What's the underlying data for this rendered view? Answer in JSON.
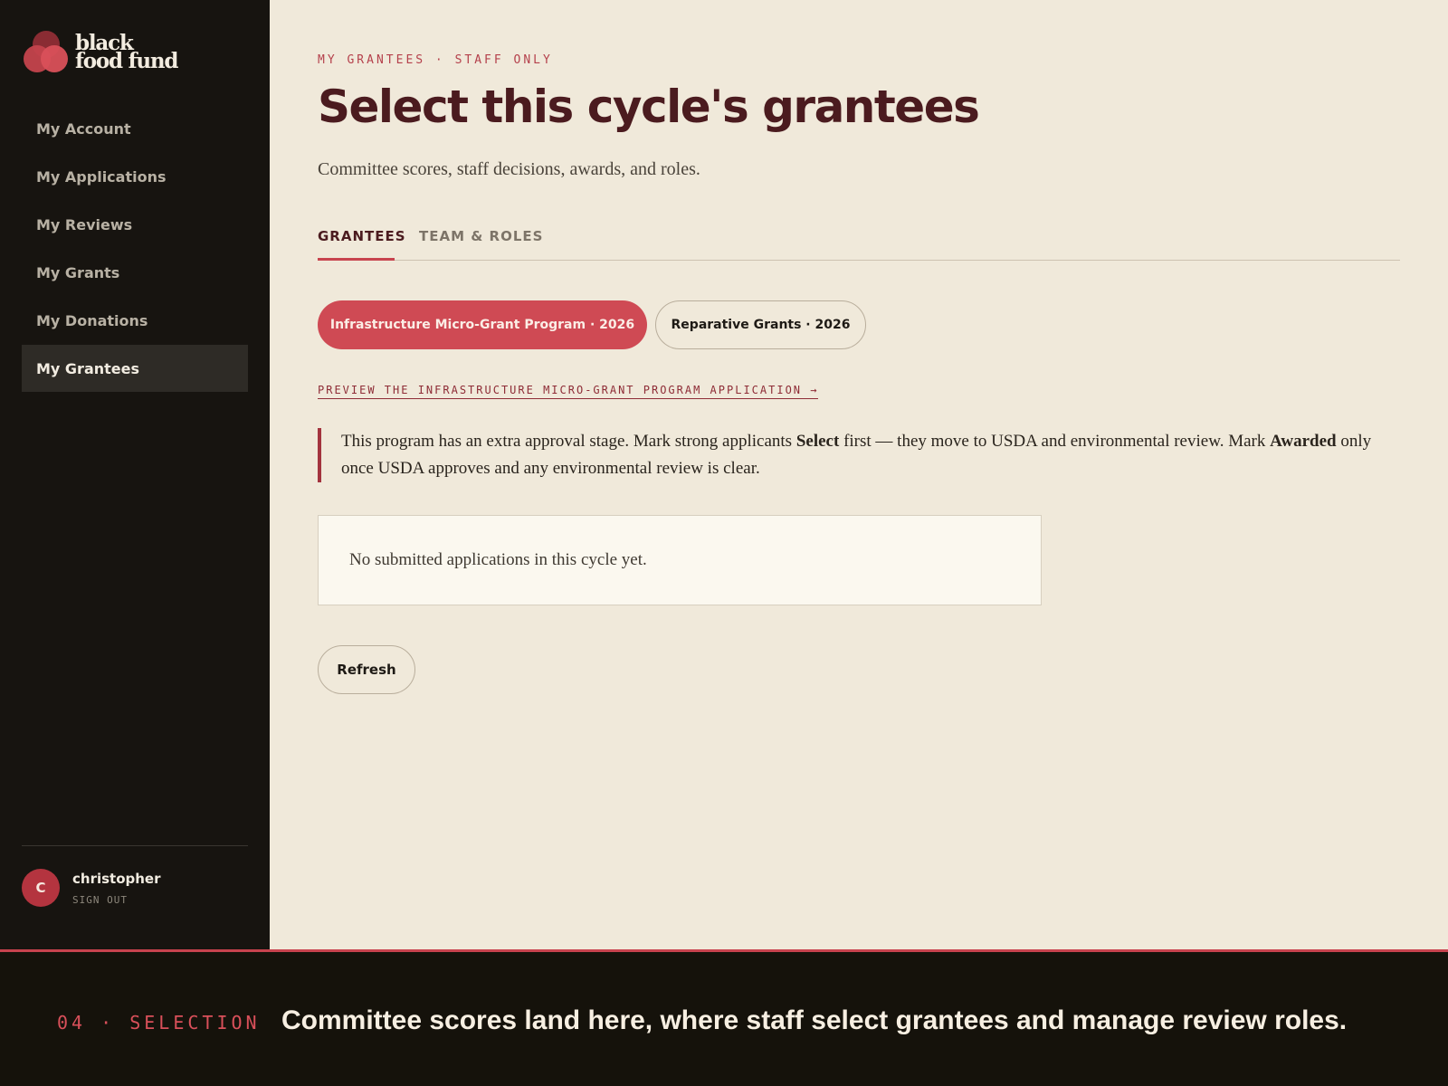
{
  "brand": {
    "logo_line1": "black",
    "logo_line2": "food fund",
    "colors": {
      "accent": "#cf4a54",
      "sidebar_bg": "#171410",
      "page_bg": "#f0e9da",
      "title": "#4b1b1f"
    }
  },
  "sidebar": {
    "items": [
      {
        "label": "My Account",
        "active": false
      },
      {
        "label": "My Applications",
        "active": false
      },
      {
        "label": "My Reviews",
        "active": false
      },
      {
        "label": "My Grants",
        "active": false
      },
      {
        "label": "My Donations",
        "active": false
      },
      {
        "label": "My Grantees",
        "active": true
      }
    ],
    "user": {
      "initial": "C",
      "name": "christopher",
      "sign_out": "SIGN OUT"
    }
  },
  "main": {
    "eyebrow": "MY GRANTEES · STAFF ONLY",
    "title": "Select this cycle's grantees",
    "subtitle": "Committee scores, staff decisions, awards, and roles.",
    "tabs": [
      {
        "label": "GRANTEES",
        "active": true
      },
      {
        "label": "TEAM & ROLES",
        "active": false
      }
    ],
    "programs": [
      {
        "label": "Infrastructure Micro-Grant Program · 2026",
        "selected": true
      },
      {
        "label": "Reparative Grants · 2026",
        "selected": false
      }
    ],
    "preview_link": "PREVIEW THE INFRASTRUCTURE MICRO-GRANT PROGRAM APPLICATION →",
    "callout": {
      "part1": "This program has an extra approval stage. Mark strong applicants ",
      "bold1": "Select",
      "part2": " first — they move to USDA and environmental review. Mark ",
      "bold2": "Awarded",
      "part3": " only once USDA approves and any environmental review is clear."
    },
    "empty_message": "No submitted applications in this cycle yet.",
    "refresh_label": "Refresh"
  },
  "footer": {
    "kicker": "04 · SELECTION",
    "caption": "Committee scores land here, where staff select grantees and manage review roles."
  }
}
